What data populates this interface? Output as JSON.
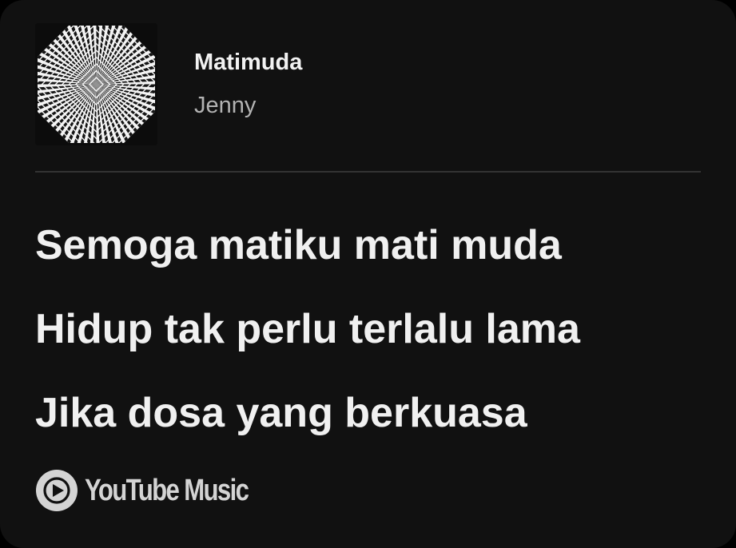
{
  "track": {
    "title": "Matimuda",
    "artist": "Jenny",
    "album_art_icon": "album-art-op-art-pattern"
  },
  "lyrics": [
    "Semoga matiku mati muda",
    "Hidup tak perlu terlalu lama",
    "Jika dosa yang berkuasa"
  ],
  "branding": {
    "logo_icon": "youtube-music-play-icon",
    "logo_text": "YouTube Music"
  },
  "colors": {
    "card_background": "#111111",
    "primary_text": "#f0f0f0",
    "secondary_text": "#b3b3b3",
    "divider": "#333333",
    "logo": "#d4d4d4"
  }
}
